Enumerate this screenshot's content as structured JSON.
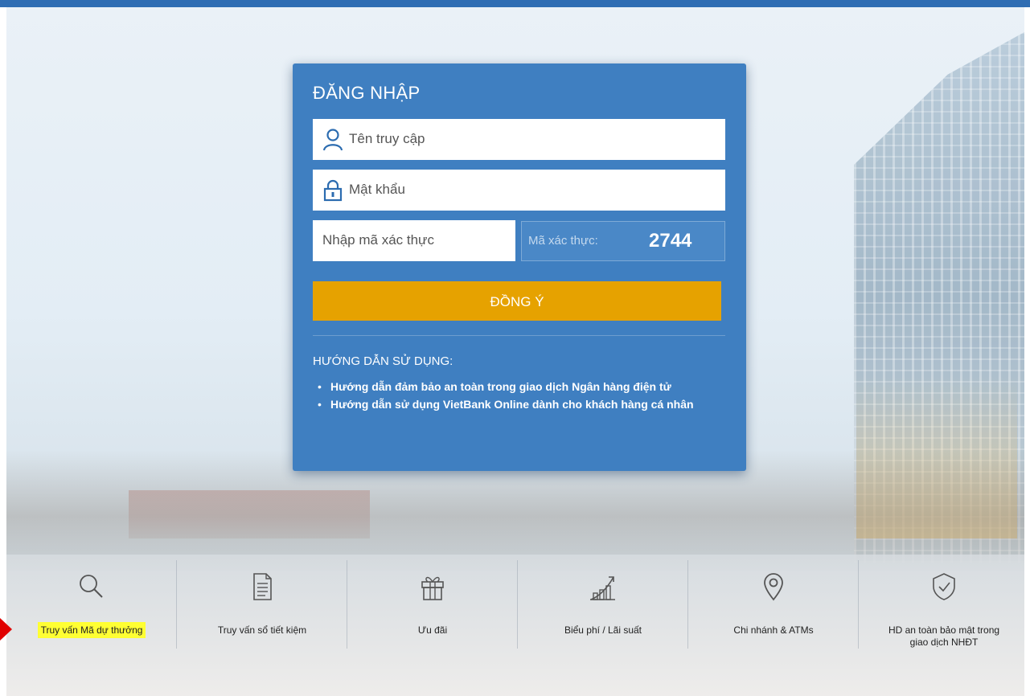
{
  "login": {
    "title": "ĐĂNG NHẬP",
    "username_placeholder": "Tên truy cập",
    "password_placeholder": "Mật khẩu",
    "captcha_placeholder": "Nhập mã xác thực",
    "captcha_label": "Mã xác thực:",
    "captcha_value": "2744",
    "submit_label": "ĐỒNG Ý",
    "guide_title": "HƯỚNG DẪN SỬ DỤNG:",
    "guide_items": [
      "Hướng dẫn đảm bảo an toàn trong giao dịch Ngân hàng điện tử",
      "Hướng dẫn sử dụng VietBank Online dành cho khách hàng cá nhân"
    ]
  },
  "quick_links": [
    {
      "label": "Truy vấn Mã dự thưởng",
      "icon": "search-icon",
      "highlighted": true
    },
    {
      "label": "Truy vấn sổ tiết kiệm",
      "icon": "document-icon"
    },
    {
      "label": "Ưu đãi",
      "icon": "gift-icon"
    },
    {
      "label": "Biểu phí / Lãi suất",
      "icon": "chart-icon"
    },
    {
      "label": "Chi nhánh & ATMs",
      "icon": "location-pin-icon"
    },
    {
      "label": "HD an toàn bảo mật trong giao dịch NHĐT",
      "icon": "shield-check-icon"
    }
  ],
  "colors": {
    "top_bar": "#2f6db3",
    "panel": "#3f7fc1",
    "submit": "#e6a200",
    "highlight": "#ffff33",
    "annotation_arrow": "#e00000"
  }
}
